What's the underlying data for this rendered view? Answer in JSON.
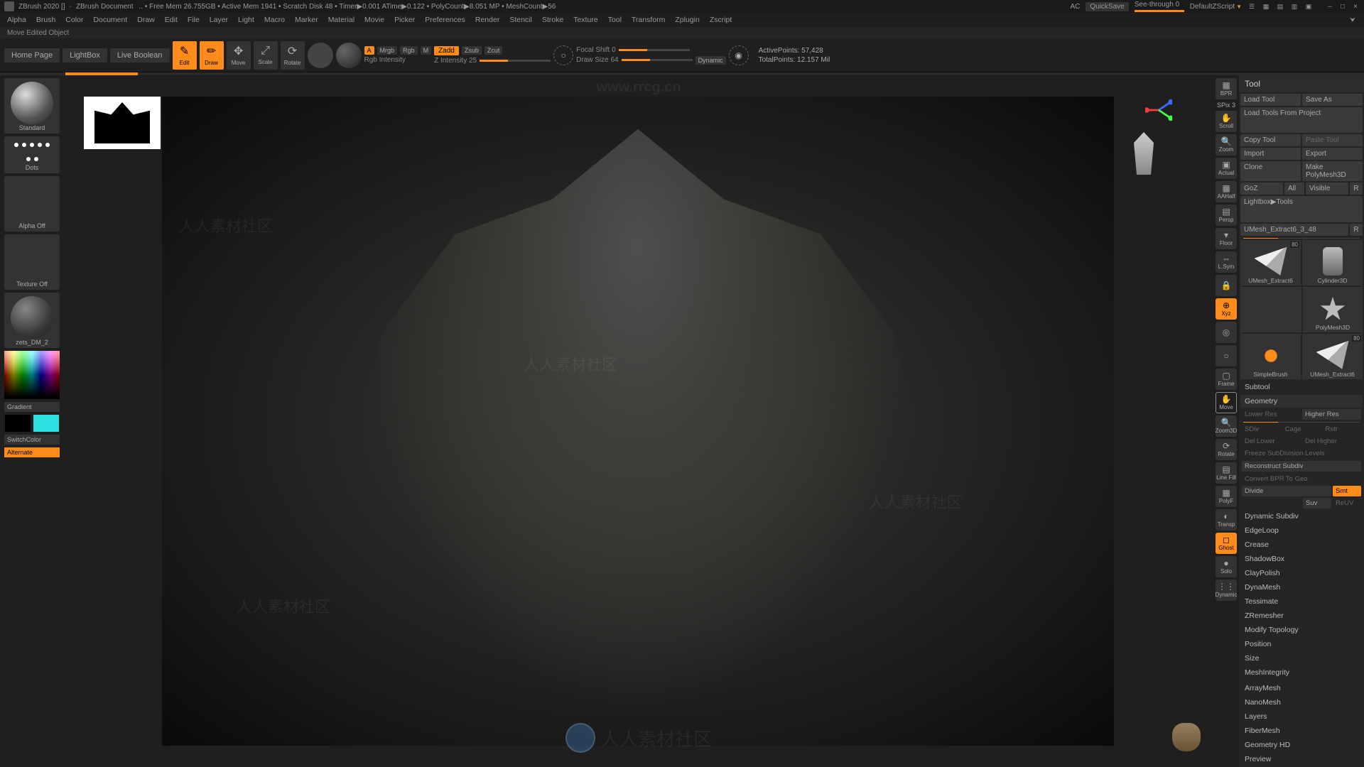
{
  "titlebar": {
    "app": "ZBrush 2020 []",
    "doc": "ZBrush Document",
    "stats": ".. • Free Mem 26.755GB • Active Mem 1941 • Scratch Disk 48 • Timer▶0.001 ATime▶0.122 • PolyCount▶8.051 MP • MeshCount▶56",
    "ac": "AC",
    "quicksave": "QuickSave",
    "seethrough": "See-through  0",
    "defaultscript": "DefaultZScript"
  },
  "menubar": [
    "Alpha",
    "Brush",
    "Color",
    "Document",
    "Draw",
    "Edit",
    "File",
    "Layer",
    "Light",
    "Macro",
    "Marker",
    "Material",
    "Movie",
    "Picker",
    "Preferences",
    "Render",
    "Stencil",
    "Stroke",
    "Texture",
    "Tool",
    "Transform",
    "Zplugin",
    "Zscript"
  ],
  "status": "Move Edited Object",
  "toolbar": {
    "tabs": [
      "Home Page",
      "LightBox",
      "Live Boolean"
    ],
    "gizmo": {
      "edit": "Edit",
      "draw": "Draw",
      "move": "Move",
      "scale": "Scale",
      "rotate": "Rotate"
    },
    "mrgb_row": {
      "a": "A",
      "mrgb": "Mrgb",
      "rgb": "Rgb",
      "m": "M"
    },
    "rgb_intensity": "Rgb Intensity",
    "zadd_row": {
      "zadd": "Zadd",
      "zsub": "Zsub",
      "zcut": "Zcut"
    },
    "zintensity": "Z Intensity 25",
    "focalshift": "Focal Shift 0",
    "drawsize": "Draw Size 64",
    "dynamic": "Dynamic",
    "stats": {
      "active": "ActivePoints: 57,428",
      "total": "TotalPoints: 12.157 Mil"
    }
  },
  "left": {
    "brush": "Standard",
    "stroke": "Dots",
    "alpha": "Alpha Off",
    "texture": "Texture Off",
    "material": "zets_DM_2",
    "gradient": "Gradient",
    "switchcolor": "SwitchColor",
    "alternate": "Alternate"
  },
  "watermarks": {
    "url": "www.rrcg.cn",
    "bottom": "人人素材社区",
    "diag": "人人素材社区"
  },
  "rightstrip": {
    "bpr": "BPR",
    "spix": "SPix",
    "spix_val": "3",
    "scroll": "Scroll",
    "zoom": "Zoom",
    "actual": "Actual",
    "aahalf": "AAHalf",
    "persp": "Persp",
    "floor": "Floor",
    "lsym": "L.Sym",
    "lock": "",
    "xyz": "Xyz",
    "frame": "Frame",
    "move": "Move",
    "zoom3d": "Zoom3D",
    "rotate": "Rotate",
    "linefill": "Line Fill",
    "polyf": "PolyF",
    "transp": "Transp",
    "ghost": "Ghost",
    "solo": "Solo",
    "dynamic": "Dynamic"
  },
  "tool": {
    "header": "Tool",
    "row1": [
      "Load Tool",
      "Save As"
    ],
    "row2": "Load Tools From Project",
    "row3": [
      "Copy Tool",
      "Paste Tool"
    ],
    "row4": [
      "Import",
      "Export"
    ],
    "row5": [
      "Clone",
      "Make PolyMesh3D"
    ],
    "row6": [
      "GoZ",
      "All",
      "Visible",
      "R"
    ],
    "row7": "Lightbox▶Tools",
    "current": "UMesh_Extract6_3_48",
    "r": "R",
    "thumbs": [
      {
        "label": "UMesh_Extract6",
        "badge": "80"
      },
      {
        "label": "Cylinder3D"
      },
      {
        "label": "PolyMesh3D"
      },
      {
        "label": "SimpleBrush"
      },
      {
        "label": "UMesh_Extract6",
        "badge": "80"
      }
    ],
    "sections": {
      "subtool": "Subtool",
      "geometry": "Geometry",
      "geo": {
        "lowerres": "Lower Res",
        "higherres": "Higher Res",
        "sdiv": "SDiv",
        "cage": "Cage",
        "rstr": "Rstr",
        "dellower": "Del Lower",
        "delhigher": "Del Higher",
        "freeze": "Freeze SubDivision Levels",
        "reconstruct": "Reconstruct Subdiv",
        "convert": "Convert BPR To Geo",
        "divide": "Divide",
        "smt": "Smt",
        "suv": "Suv",
        "reuv": "ReUV"
      },
      "list": [
        "Dynamic Subdiv",
        "EdgeLoop",
        "Crease",
        "ShadowBox",
        "ClayPolish",
        "DynaMesh",
        "Tessimate",
        "ZRemesher",
        "Modify Topology",
        "Position",
        "Size",
        "MeshIntegrity"
      ],
      "bottom": [
        "ArrayMesh",
        "NanoMesh",
        "Layers",
        "FiberMesh",
        "Geometry HD",
        "Preview"
      ]
    }
  }
}
